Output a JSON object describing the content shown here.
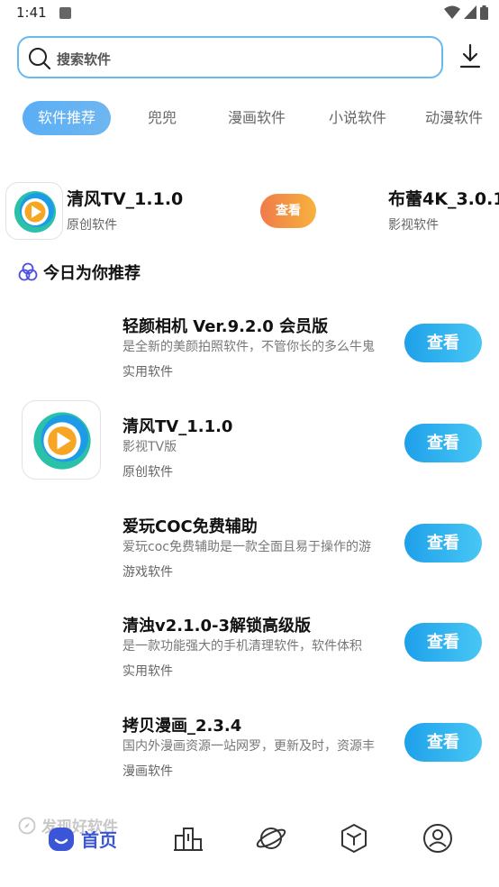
{
  "status_bar": {
    "time": "1:41",
    "notif_icon": "a-notification-icon"
  },
  "search": {
    "placeholder": "搜索软件"
  },
  "tabs": [
    {
      "label": "软件推荐",
      "active": true
    },
    {
      "label": "兜兜",
      "active": false
    },
    {
      "label": "漫画软件",
      "active": false
    },
    {
      "label": "小说软件",
      "active": false
    },
    {
      "label": "动漫软件",
      "active": false
    }
  ],
  "banner": {
    "items": [
      {
        "title": "清风TV_1.1.0",
        "subtitle": "原创软件",
        "button": "查看"
      },
      {
        "title": "布蕾4K_3.0.1",
        "subtitle": "影视软件"
      }
    ]
  },
  "recommend": {
    "title": "今日为你推荐",
    "items": [
      {
        "title": "轻颜相机 Ver.9.2.0 会员版",
        "desc": "是全新的美颜拍照软件，不管你长的多么牛鬼",
        "category": "实用软件",
        "button": "查看",
        "has_logo": false
      },
      {
        "title": "清风TV_1.1.0",
        "desc": "影视TV版",
        "category": "原创软件",
        "button": "查看",
        "has_logo": true
      },
      {
        "title": "爱玩COC免费辅助",
        "desc": "爱玩coc免费辅助是一款全面且易于操作的游",
        "category": "游戏软件",
        "button": "查看",
        "has_logo": false
      },
      {
        "title": "清浊v2.1.0-3解锁高级版",
        "desc": "是一款功能强大的手机清理软件，软件体积",
        "category": "实用软件",
        "button": "查看",
        "has_logo": false
      },
      {
        "title": "拷贝漫画_2.3.4",
        "desc": "国内外漫画资源一站网罗，更新及时，资源丰",
        "category": "漫画软件",
        "button": "查看",
        "has_logo": false
      }
    ]
  },
  "faded_section": {
    "title": "发现好软件"
  },
  "bottom_nav": {
    "home_label": "首页",
    "items": [
      "home-icon",
      "ranking-icon",
      "planet-icon",
      "box-icon",
      "profile-icon"
    ]
  },
  "colors": {
    "accent_blue": "#1ea0ea",
    "tab_active": "#5aaef5",
    "banner_button": "#f07b4a",
    "nav_active": "#3a55d8"
  }
}
